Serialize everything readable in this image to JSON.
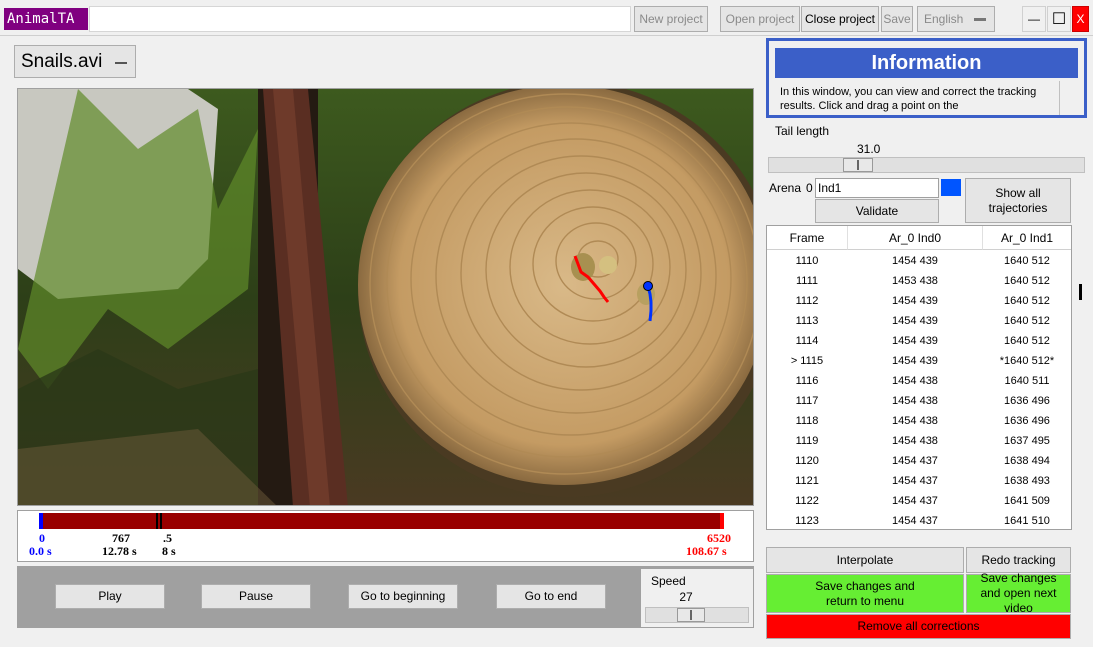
{
  "app": {
    "logo": "AnimalTA"
  },
  "toolbar": {
    "new_project": "New project",
    "open_project": "Open project",
    "close_project": "Close project",
    "save": "Save",
    "language": "English"
  },
  "window_controls": {
    "minimize": "—",
    "maximize": "☐",
    "close": "X"
  },
  "video": {
    "file_name": "Snails.avi",
    "dropdown_icon": "dropdown-icon"
  },
  "timeline": {
    "start_frame": "0",
    "start_time": "0.0 s",
    "current_frame": "767",
    "current_time": "12.78 s",
    "marker_frame": ".5",
    "marker_time": "8 s",
    "end_frame": "6520",
    "end_time": "108.67 s",
    "colors": {
      "bar": "#990000",
      "start": "#0000ff",
      "end": "#ff0000"
    }
  },
  "controls": {
    "play": "Play",
    "pause": "Pause",
    "go_to_beginning": "Go to beginning",
    "go_to_end": "Go to end",
    "speed_label": "Speed",
    "speed_value": "27",
    "speed_fraction": 0.42
  },
  "info": {
    "title": "Information",
    "text": "In this window, you can view and correct the tracking results. Click and drag a point on the"
  },
  "tail": {
    "label": "Tail length",
    "value": "31.0",
    "fraction": 0.26
  },
  "arena": {
    "label": "Arena",
    "number": "0",
    "individual_name": "Ind1",
    "color": "#0055ff",
    "validate": "Validate",
    "show_all": "Show all trajectories"
  },
  "table": {
    "headers": [
      "Frame",
      "Ar_0 Ind0",
      "Ar_0 Ind1"
    ],
    "rows": [
      [
        "1110",
        "1454 439",
        "1640 512"
      ],
      [
        "1111",
        "1453 438",
        "1640 512"
      ],
      [
        "1112",
        "1454 439",
        "1640 512"
      ],
      [
        "1113",
        "1454 439",
        "1640 512"
      ],
      [
        "1114",
        "1454 439",
        "1640 512"
      ],
      [
        "> 1115",
        "1454 439",
        "*1640 512*"
      ],
      [
        "1116",
        "1454 438",
        "1640 511"
      ],
      [
        "1117",
        "1454 438",
        "1636 496"
      ],
      [
        "1118",
        "1454 438",
        "1636 496"
      ],
      [
        "1119",
        "1454 438",
        "1637 495"
      ],
      [
        "1120",
        "1454 437",
        "1638 494"
      ],
      [
        "1121",
        "1454 437",
        "1638 493"
      ],
      [
        "1122",
        "1454 437",
        "1641 509"
      ],
      [
        "1123",
        "1454 437",
        "1641 510"
      ]
    ]
  },
  "actions": {
    "interpolate": "Interpolate",
    "redo_tracking": "Redo tracking",
    "save_menu": "Save changes and return to menu",
    "save_next": "Save changes and open next video",
    "remove_all": "Remove all corrections",
    "colors": {
      "save": "#66ee33",
      "remove": "#ff0000"
    }
  },
  "trajectories": {
    "ind0_color": "#ff0000",
    "ind1_color": "#0033ff"
  }
}
